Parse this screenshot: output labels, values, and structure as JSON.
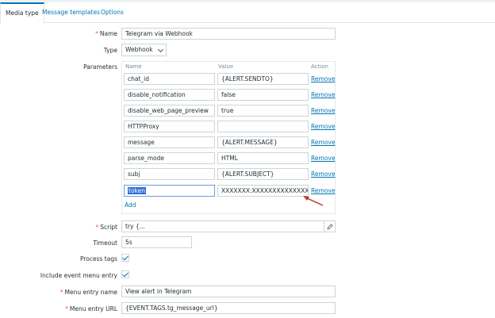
{
  "tabs": [
    {
      "label": "Media type",
      "active": true
    },
    {
      "label": "Message templates",
      "active": false
    },
    {
      "label": "Options",
      "active": false
    }
  ],
  "form": {
    "name_label": "Name",
    "name_value": "Telegram via Webhook",
    "type_label": "Type",
    "type_value": "Webhook",
    "parameters_label": "Parameters",
    "col_name": "Name",
    "col_value": "Value",
    "col_action": "Action",
    "remove_label": "Remove",
    "add_label": "Add",
    "parameters": [
      {
        "name": "chat_id",
        "value": "{ALERT.SENDTO}"
      },
      {
        "name": "disable_notification",
        "value": "false"
      },
      {
        "name": "disable_web_page_preview",
        "value": "true"
      },
      {
        "name": "HTTPProxy",
        "value": ""
      },
      {
        "name": "message",
        "value": "{ALERT.MESSAGE}"
      },
      {
        "name": "parse_mode",
        "value": "HTML"
      },
      {
        "name": "subj",
        "value": "{ALERT.SUBJECT}"
      },
      {
        "name": "token",
        "value": "XXXXXXX:XXXXXXXXXXXXXXXX"
      }
    ],
    "script_label": "Script",
    "script_value": "try {...",
    "timeout_label": "Timeout",
    "timeout_value": "5s",
    "process_tags_label": "Process tags",
    "event_menu_label": "Include event menu entry",
    "menu_name_label": "Menu entry name",
    "menu_name_value": "View alert in Telegram",
    "menu_url_label": "Menu entry URL",
    "menu_url_value": "{EVENT.TAGS.tg_message_url}"
  },
  "colors": {
    "accent": "#0275b8",
    "required": "#e45959",
    "arrow": "#c0392b"
  },
  "icons": {
    "script_edit": "pencil-icon",
    "type_dropdown": "chevron-down-icon"
  }
}
